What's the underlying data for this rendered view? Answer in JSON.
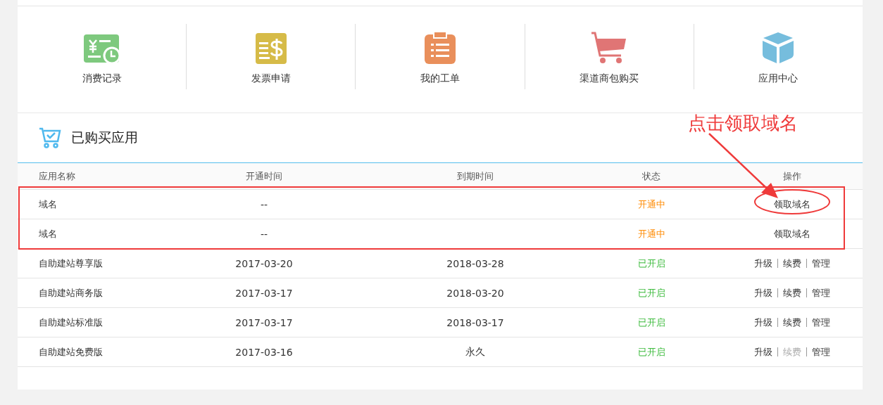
{
  "shortcuts": [
    {
      "label": "消费记录",
      "kind": "receipt"
    },
    {
      "label": "发票申请",
      "kind": "invoice"
    },
    {
      "label": "我的工单",
      "kind": "clipboard"
    },
    {
      "label": "渠道商包购买",
      "kind": "cart"
    },
    {
      "label": "应用中心",
      "kind": "box"
    }
  ],
  "section": {
    "title": "已购买应用"
  },
  "annotation": {
    "text": "点击领取域名"
  },
  "table": {
    "columns": [
      "应用名称",
      "开通时间",
      "到期时间",
      "状态",
      "操作"
    ],
    "rows": [
      {
        "name": "域名",
        "opened": "--",
        "status": {
          "text": "开通中",
          "kind": "pending"
        },
        "actions": [
          {
            "label": "领取域名",
            "disabled": false
          }
        ],
        "marked": true,
        "circled": true
      },
      {
        "name": "域名",
        "opened": "--",
        "status": {
          "text": "开通中",
          "kind": "pending"
        },
        "actions": [
          {
            "label": "领取域名",
            "disabled": false
          }
        ],
        "marked": true,
        "circled": false
      },
      {
        "name": "自助建站尊享版",
        "opened": "2017-03-20",
        "expires": "2018-03-28",
        "status": {
          "text": "已开启",
          "kind": "active"
        },
        "actions": [
          {
            "label": "升级",
            "disabled": false
          },
          {
            "label": "续费",
            "disabled": false
          },
          {
            "label": "管理",
            "disabled": false
          }
        ],
        "marked": false,
        "circled": false
      },
      {
        "name": "自助建站商务版",
        "opened": "2017-03-17",
        "expires": "2018-03-20",
        "status": {
          "text": "已开启",
          "kind": "active"
        },
        "actions": [
          {
            "label": "升级",
            "disabled": false
          },
          {
            "label": "续费",
            "disabled": false
          },
          {
            "label": "管理",
            "disabled": false
          }
        ],
        "marked": false,
        "circled": false
      },
      {
        "name": "自助建站标准版",
        "opened": "2017-03-17",
        "expires": "2018-03-17",
        "status": {
          "text": "已开启",
          "kind": "active"
        },
        "actions": [
          {
            "label": "升级",
            "disabled": false
          },
          {
            "label": "续费",
            "disabled": false
          },
          {
            "label": "管理",
            "disabled": false
          }
        ],
        "marked": false,
        "circled": false
      },
      {
        "name": "自助建站免费版",
        "opened": "2017-03-16",
        "expires": "永久",
        "status": {
          "text": "已开启",
          "kind": "active"
        },
        "actions": [
          {
            "label": "升级",
            "disabled": false
          },
          {
            "label": "续费",
            "disabled": true
          },
          {
            "label": "管理",
            "disabled": false
          }
        ],
        "marked": false,
        "circled": false
      }
    ]
  }
}
